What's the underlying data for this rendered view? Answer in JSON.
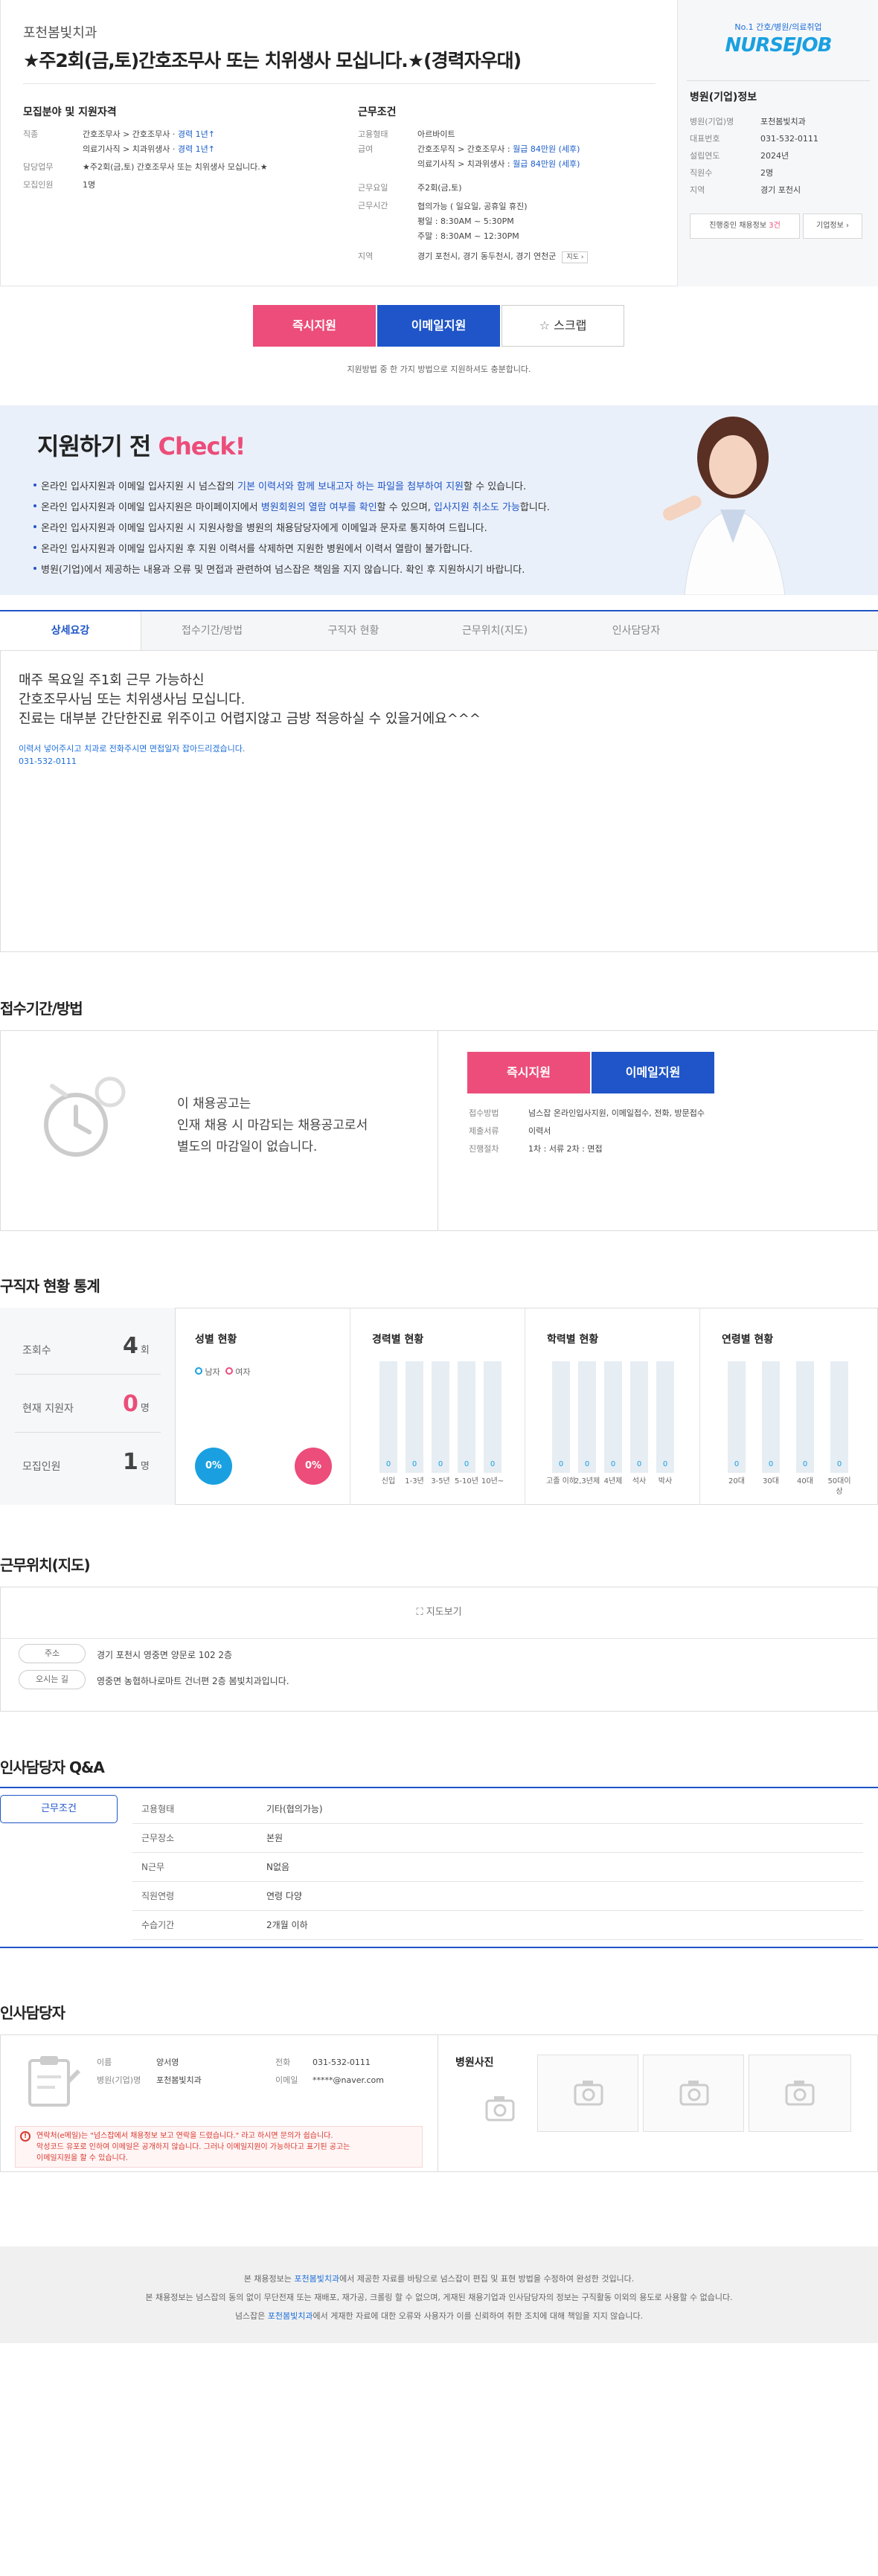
{
  "header": {
    "hospital_name": "포천봄빛치과",
    "job_title": "★주2회(금,토)간호조무사 또는 치위생사 모십니다.★(경력자우대)",
    "qualification": {
      "heading": "모집분야 및 지원자격",
      "rows": [
        {
          "k": "직종",
          "v1": "간호조무사 > 간호조무사 · ",
          "v1b": "경력 1년↑"
        },
        {
          "k": "",
          "v1": "의료기사직 > 치과위생사 · ",
          "v1b": "경력 1년↑"
        },
        {
          "k": "담당업무",
          "v1": "★주2회(금,토) 간호조무사 또는 치위생사 모십니다.★",
          "v1b": ""
        },
        {
          "k": "모집인원",
          "v1": "1명",
          "v1b": ""
        }
      ]
    },
    "conditions": {
      "heading": "근무조건",
      "employment_label": "고용형태",
      "employment_value": "아르바이트",
      "pay_label": "급여",
      "pay1": "간호조무직 > 간호조무사 : ",
      "pay1b": "월급 84만원 (세후)",
      "pay2": "의료기사직 > 치과위생사 : ",
      "pay2b": "월급 84만원 (세후)",
      "days_label": "근무요일",
      "days_value": "주2회(금,토)",
      "hours_label": "근무시간",
      "hours1": "협의가능 ( 일요일, 공휴일 휴진)",
      "hours2": "평일 : 8:30AM ~ 5:30PM",
      "hours3": "주말 : 8:30AM ~ 12:30PM",
      "region_label": "지역",
      "region_value": "경기 포천시, 경기 동두천시, 경기 연천군",
      "map_label": "지도"
    }
  },
  "side": {
    "tagline": "No.1 간호/병원/의료취업",
    "logo": "NURSEJOB",
    "heading": "병원(기업)정보",
    "rows": [
      {
        "k": "병원(기업)명",
        "v": "포천봄빛치과"
      },
      {
        "k": "대표번호",
        "v": "031-532-0111"
      },
      {
        "k": "설립연도",
        "v": "2024년"
      },
      {
        "k": "직원수",
        "v": "2명"
      },
      {
        "k": "지역",
        "v": "경기 포천시"
      }
    ],
    "ongoing_label": "진행중인 채용정보",
    "ongoing_count": "3건",
    "company_info_label": "기업정보"
  },
  "apply": {
    "instant": "즉시지원",
    "email": "이메일지원",
    "scrap": "스크랩",
    "note": "지원방법 중 한 가지 방법으로 지원하셔도 충분합니다."
  },
  "check": {
    "title_a": "지원하기 전 ",
    "title_b": "Check!",
    "items": [
      {
        "a": "온라인 입사지원과 이메일 입사지원 시 넘스잡의 ",
        "b": "기본 이력서와 함께 보내고자 하는 파일을 첨부하여 지원",
        "c": "할 수 있습니다.",
        "d": "",
        "e": ""
      },
      {
        "a": "온라인 입사지원과 이메일 입사지원은 마이페이지에서 ",
        "b": "병원회원의 열람 여부를 확인",
        "c": "할 수 있으며, ",
        "d": "입사지원 취소도 가능",
        "e": "합니다."
      },
      {
        "a": "온라인 입사지원과 이메일 입사지원 시 지원사항을 병원의 채용담당자에게 이메일과 문자로 통지하여 드립니다.",
        "b": "",
        "c": "",
        "d": "",
        "e": ""
      },
      {
        "a": "온라인 입사지원과 이메일 입사지원 후 지원 이력서를 삭제하면 지원한 병원에서 이력서 열람이 불가합니다.",
        "b": "",
        "c": "",
        "d": "",
        "e": ""
      },
      {
        "a": "병원(기업)에서 제공하는 내용과 오류 및 면접과 관련하여 넘스잡은 책임을 지지 않습니다. 확인 후 지원하시기 바랍니다.",
        "b": "",
        "c": "",
        "d": "",
        "e": ""
      }
    ]
  },
  "tabs": [
    "상세요강",
    "접수기간/방법",
    "구직자 현황",
    "근무위치(지도)",
    "인사담당자"
  ],
  "detail": {
    "line1": "매주 목요일 주1회 근무 가능하신",
    "line2": "간호조무사님 또는 치위생사님 모십니다.",
    "line3": "진료는 대부분 간단한진료 위주이고 어렵지않고 금방 적응하실 수 있을거에요^^^",
    "contact1": "이력서 넣어주시고 치과로 전화주시면 면접일자 잡아드리겠습니다.",
    "contact2": "031-532-0111"
  },
  "period": {
    "heading": "접수기간/방법",
    "msg1": "이 채용공고는",
    "msg2": "인재 채용 시 마감되는 채용공고로서",
    "msg3": "별도의 마감일이 없습니다.",
    "instant": "즉시지원",
    "email": "이메일지원",
    "method_label": "접수방법",
    "method_value": "넘스잡 온라인입사지원, 이메일접수, 전화, 방문접수",
    "docs_label": "제출서류",
    "docs_value": "이력서",
    "process_label": "진행절차",
    "process_value": "1차 : 서류   2차 : 면접"
  },
  "stats": {
    "heading": "구직자 현황 통계",
    "views_label": "조회수",
    "views_value": "4",
    "views_unit": "회",
    "applicants_label": "현재 지원자",
    "applicants_value": "0",
    "applicants_unit": "명",
    "recruit_label": "모집인원",
    "recruit_value": "1",
    "recruit_unit": "명",
    "gender_title": "성별 현황",
    "male": "남자",
    "female": "여자",
    "male_pct": "0%",
    "female_pct": "0%",
    "career_title": "경력별 현황",
    "career_labels": [
      "신입",
      "1-3년",
      "3-5년",
      "5-10년",
      "10년~"
    ],
    "career_values": [
      "0",
      "0",
      "0",
      "0",
      "0"
    ],
    "edu_title": "학력별 현황",
    "edu_labels": [
      "고졸 이하",
      "2,3년제",
      "4년제",
      "석사",
      "박사"
    ],
    "edu_values": [
      "0",
      "0",
      "0",
      "0",
      "0"
    ],
    "age_title": "연령별 현황",
    "age_labels": [
      "20대",
      "30대",
      "40대",
      "50대이상"
    ],
    "age_values": [
      "0",
      "0",
      "0",
      "0"
    ]
  },
  "location": {
    "heading": "근무위치(지도)",
    "map_button": "지도보기",
    "address_label": "주소",
    "address_value": "경기 포천시 영중면 양문로 102 2층",
    "route_label": "오시는 길",
    "route_value": "영중면 농협하나로마트 건너편 2층 봄빛치과입니다."
  },
  "qa": {
    "heading": "인사담당자 Q&A",
    "tab": "근무조건",
    "rows": [
      {
        "k": "고용형태",
        "v": "기타(협의가능)"
      },
      {
        "k": "근무장소",
        "v": "본원"
      },
      {
        "k": "N근무",
        "v": "N없음"
      },
      {
        "k": "직원연령",
        "v": "연령 다양"
      },
      {
        "k": "수습기간",
        "v": "2개월 이하"
      }
    ]
  },
  "manager": {
    "heading": "인사담당자",
    "name_label": "이름",
    "name_value": "양서영",
    "phone_label": "전화",
    "phone_value": "031-532-0111",
    "hospital_label": "병원(기업)명",
    "hospital_value": "포천봄빛치과",
    "email_label": "이메일",
    "email_value": "*****@naver.com",
    "photos_title": "병원사진",
    "warn1": "연락처(e메일)는 \"넘스잡에서 채용정보 보고 연락을 드렸습니다.\" 라고 하시면 문의가 쉽습니다.",
    "warn2": "악성코드 유포로 인하여 이메일은 공개하지 않습니다. 그러나 이메일지원이 가능하다고 표기된 공고는",
    "warn3": "이메일지원을 할 수 있습니다."
  },
  "footer": {
    "l1a": "본 채용정보는 ",
    "l1b": "포천봄빛치과",
    "l1c": "에서 제공한 자료를 바탕으로 넘스잡이 편집 및 표현 방법을 수정하여 완성한 것입니다.",
    "l2": "본 채용정보는 넘스잡의 동의 없이 무단전재 또는 재배포, 재가공, 크롤링 할 수 없으며, 게재된 채용기업과 인사담당자의 정보는 구직활동 이외의 용도로 사용할 수 없습니다.",
    "l3a": "넘스잡은 ",
    "l3b": "포천봄빛치과",
    "l3c": "에서 게재한 자료에 대한 오류와 사용자가 이를 신뢰하여 취한 조치에 대해 책임을 지지 않습니다."
  },
  "colors": {
    "pink": "#ec4d7a",
    "blue": "#1f55c8",
    "accent": "#1aa0e0"
  }
}
